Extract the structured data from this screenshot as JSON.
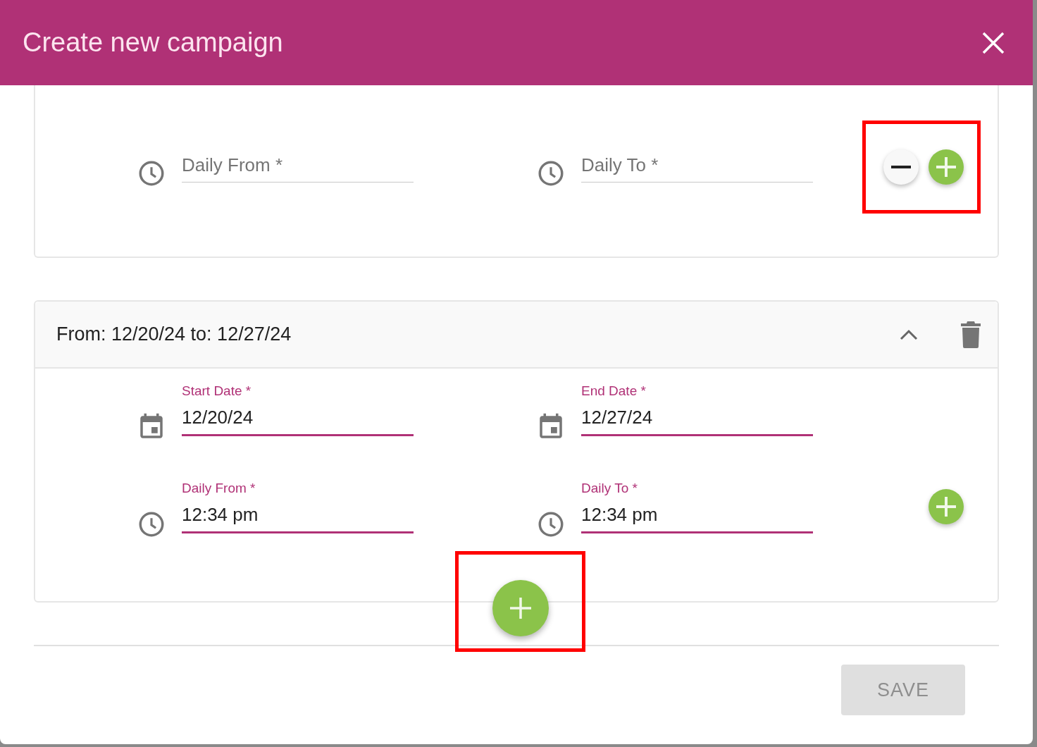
{
  "dialog": {
    "title": "Create new campaign"
  },
  "cards": [
    {
      "kind": "cut",
      "rows": [
        {
          "fields": [
            {
              "kind": "time",
              "placeholder": "Daily From *"
            },
            {
              "kind": "time",
              "placeholder": "Daily To *"
            }
          ],
          "controls": {
            "remove": true,
            "add": true,
            "highlighted": true
          }
        }
      ]
    },
    {
      "kind": "full",
      "header": {
        "title": "From: 12/20/24 to: 12/27/24",
        "expanded": true
      },
      "rows": [
        {
          "fields": [
            {
              "kind": "date",
              "label": "Start Date *",
              "value": "12/20/24"
            },
            {
              "kind": "date",
              "label": "End Date *",
              "value": "12/27/24"
            }
          ],
          "controls": {
            "remove": false,
            "add": false,
            "highlighted": false
          }
        },
        {
          "fields": [
            {
              "kind": "time",
              "label": "Daily From *",
              "value": "12:34 pm"
            },
            {
              "kind": "time",
              "label": "Daily To *",
              "value": "12:34 pm"
            }
          ],
          "controls": {
            "remove": false,
            "add": true,
            "highlighted": false
          }
        }
      ],
      "fab": {
        "highlighted": true
      }
    }
  ],
  "save_button": {
    "label": "SAVE",
    "disabled": true
  }
}
